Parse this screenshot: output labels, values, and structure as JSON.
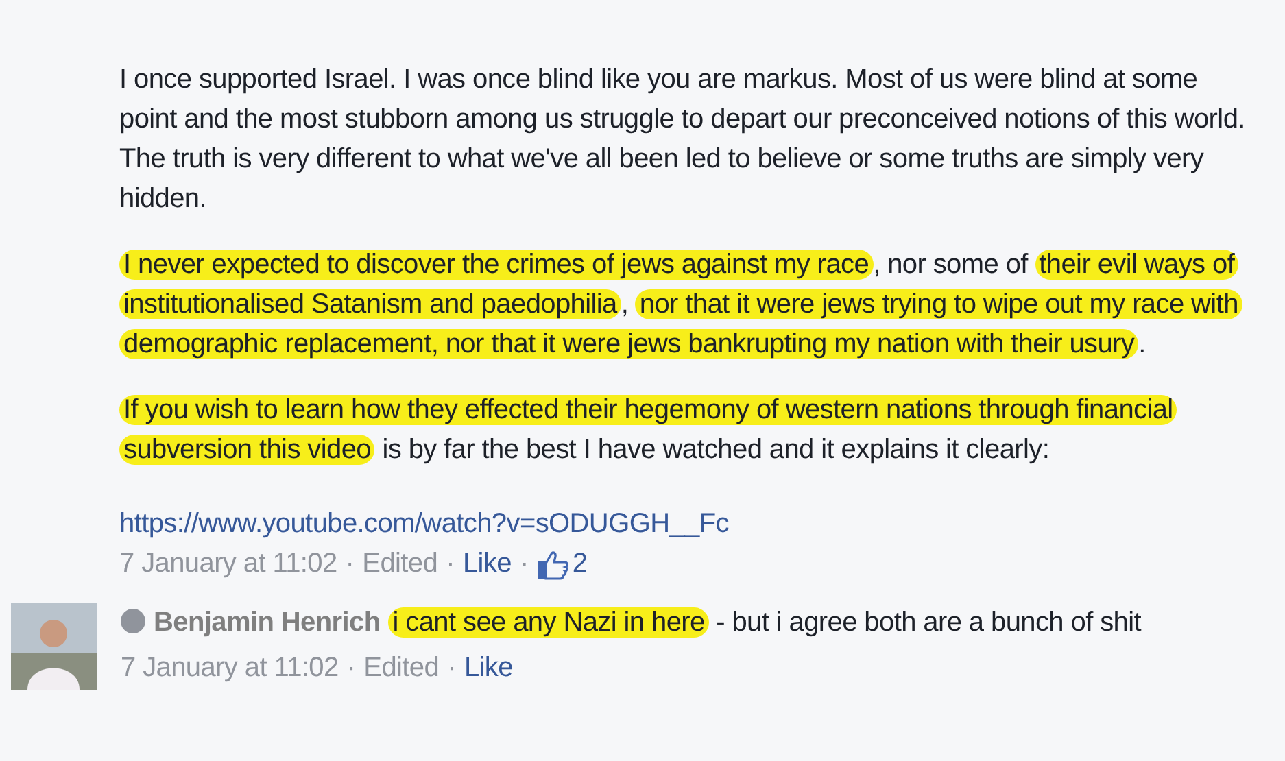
{
  "comment": {
    "paragraphs": [
      {
        "segments": [
          {
            "text": "I once supported Israel. I was once blind like you are markus. Most of us were blind at some point and the most stubborn among us struggle to depart our preconceived notions of this world. The truth is very different to what we've all been led to believe or some truths are simply very hidden.",
            "highlighted": false
          }
        ]
      },
      {
        "segments": [
          {
            "text": "I never expected to discover the crimes of jews against my race",
            "highlighted": true
          },
          {
            "text": ", nor some of ",
            "highlighted": false
          },
          {
            "text": "their evil ways of institutionalised Satanism and paedophilia",
            "highlighted": true
          },
          {
            "text": ", ",
            "highlighted": false
          },
          {
            "text": "nor that it were jews trying to wipe out my race with demographic replacement, nor that it were jews bankrupting my nation with their usury",
            "highlighted": true
          },
          {
            "text": ".",
            "highlighted": false
          }
        ]
      },
      {
        "segments": [
          {
            "text": "If you wish to learn how they effected their hegemony of western nations through financial subversion this video",
            "highlighted": true
          },
          {
            "text": " is by far the best I have watched and it explains it clearly:",
            "highlighted": false
          }
        ]
      }
    ],
    "link": "https://www.youtube.com/watch?v=sODUGGH__Fc",
    "time": "7 January at 11:02",
    "separator": "·",
    "edited": "Edited",
    "like": "Like",
    "like_count": "2"
  },
  "reply": {
    "author": "Benjamin Henrich",
    "segments": [
      {
        "text": "i cant see any Nazi in here",
        "highlighted": true
      },
      {
        "text": " - but i agree both are a bunch of shit",
        "highlighted": false
      }
    ],
    "time": "7 January at 11:02",
    "separator": "·",
    "edited": "Edited",
    "like": "Like"
  }
}
